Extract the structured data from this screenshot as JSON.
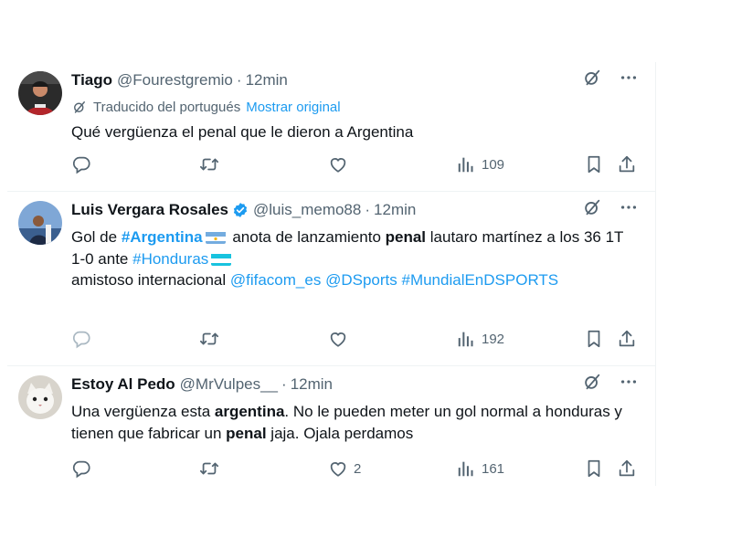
{
  "tweets": [
    {
      "name": "Tiago",
      "handle": "@Fourestgremio",
      "separator": "·",
      "time": "12min",
      "translated_label": "Traducido del portugués",
      "show_original": "Mostrar original",
      "text": "Qué vergüenza el penal que le dieron a Argentina",
      "views": "109"
    },
    {
      "name": "Luis Vergara Rosales",
      "handle": "@luis_memo88",
      "separator": "·",
      "time": "12min",
      "verified": true,
      "line1": {
        "pre": "Gol de ",
        "hashtag": "#Argentina",
        "mid": " anota de lanzamiento ",
        "bold": "penal",
        "post": " lautaro martínez a los 36 1T"
      },
      "line2": {
        "pre": "1-0 ante ",
        "hashtag": "#Honduras"
      },
      "line3": {
        "pre": "amistoso internacional ",
        "mention1": "@fifacom_es",
        "mention2": "@DSports",
        "hashtag": "#MundialEnDSPORTS"
      },
      "views": "192"
    },
    {
      "name": "Estoy Al Pedo",
      "handle": "@MrVulpes__",
      "separator": "·",
      "time": "12min",
      "text_parts": {
        "p1": "Una vergüenza esta ",
        "b1": "argentina",
        "p2": ". No le pueden meter un gol normal a honduras y tienen que fabricar un ",
        "b2": "penal",
        "p3": " jaja. Ojala perdamos"
      },
      "likes": "2",
      "views": "161"
    }
  ],
  "icons": {
    "reply": "reply-icon",
    "retweet": "retweet-icon",
    "like": "like-icon",
    "views": "views-icon",
    "bookmark": "bookmark-icon",
    "share": "share-icon",
    "grok": "grok-icon",
    "more": "more-icon"
  },
  "colors": {
    "link": "#1d9bf0",
    "secondary_text": "#536471",
    "primary_text": "#0f1419",
    "verified": "#1d9bf0"
  }
}
